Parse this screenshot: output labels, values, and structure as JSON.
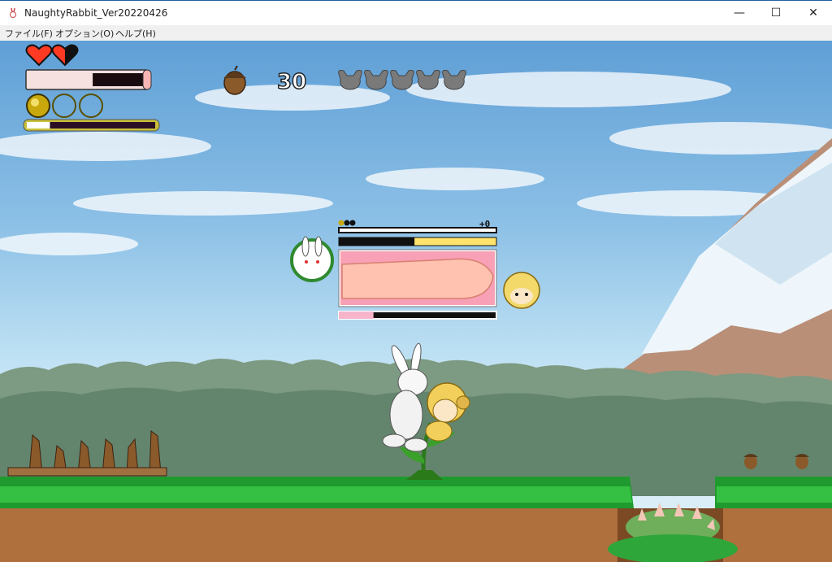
{
  "window": {
    "title": "NaughtyRabbit_Ver20220426",
    "minimize": "—",
    "maximize": "☐",
    "close": "✕"
  },
  "menu": [
    "ファイル(F)",
    "オプション(O)",
    "ヘルプ(H)"
  ],
  "hud": {
    "hearts": [
      "full",
      "half"
    ],
    "acorn_count": "30",
    "stamina_fraction": 0.55,
    "orbs": [
      "filled",
      "empty",
      "empty"
    ],
    "charge_fraction": 0.18,
    "rabbit_heads": 5
  },
  "encounter": {
    "bonus": "+0",
    "struggle_fraction": 0.48,
    "enemy_gauge_fraction": 0.22
  }
}
